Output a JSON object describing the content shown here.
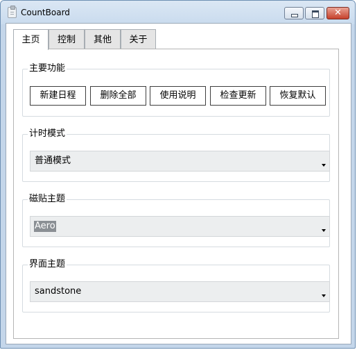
{
  "window": {
    "title": "CountBoard",
    "close_glyph": "✕"
  },
  "tabs": [
    {
      "label": "主页",
      "active": true
    },
    {
      "label": "控制",
      "active": false
    },
    {
      "label": "其他",
      "active": false
    },
    {
      "label": "关于",
      "active": false
    }
  ],
  "main_functions": {
    "label": "主要功能",
    "buttons": [
      "新建日程",
      "删除全部",
      "使用说明",
      "检查更新",
      "恢复默认"
    ]
  },
  "timer_mode": {
    "label": "计时模式",
    "value": "普通模式"
  },
  "tile_theme": {
    "label": "磁贴主题",
    "value": "Aero"
  },
  "ui_theme": {
    "label": "界面主题",
    "value": "sandstone"
  },
  "colors": {
    "titlebar": "#c9dbee",
    "close_button": "#c6402b",
    "combo_bg": "#eceeef"
  },
  "icons": {
    "app": "clipboard-icon",
    "minimize": "minimize-icon",
    "maximize": "maximize-icon",
    "close": "close-icon",
    "dropdown": "chevron-down-icon"
  }
}
